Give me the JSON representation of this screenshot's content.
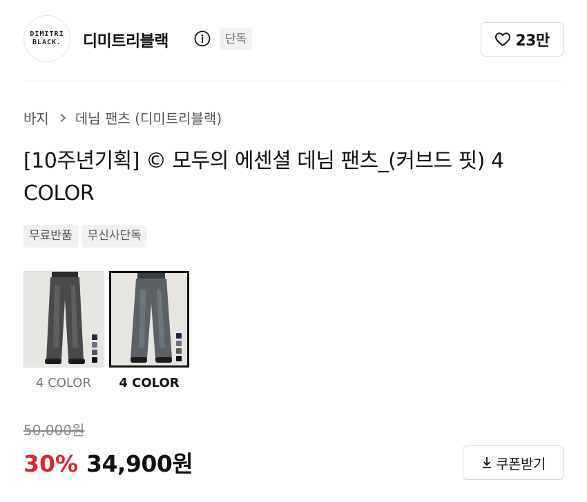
{
  "brand": {
    "logo_lines": [
      "DIMITRI",
      "BLACK."
    ],
    "name": "디미트리블랙",
    "badge": "단독",
    "likes": "23만"
  },
  "breadcrumb": {
    "category": "바지",
    "subcategory": "데님 팬츠 (디미트리블랙)"
  },
  "product": {
    "title": "[10주년기획] © 모두의 에센셜 데님 팬츠_(커브드 핏) 4 COLOR",
    "tags": [
      "무료반품",
      "무신사단독"
    ]
  },
  "options": [
    {
      "label": "4 COLOR",
      "selected": false,
      "swatches": [
        "#1f2a44",
        "#6b7280",
        "#5a5a5a",
        "#111111"
      ]
    },
    {
      "label": "4 COLOR",
      "selected": true,
      "swatches": [
        "#1f2a44",
        "#6b7280",
        "#5a5a5a",
        "#111111"
      ]
    }
  ],
  "price": {
    "original": "50,000원",
    "discount": "30%",
    "sale": "34,900원",
    "coupon_label": "쿠폰받기"
  },
  "colors": {
    "discount_red": "#e0252a",
    "text": "#111111",
    "muted": "#888888"
  }
}
